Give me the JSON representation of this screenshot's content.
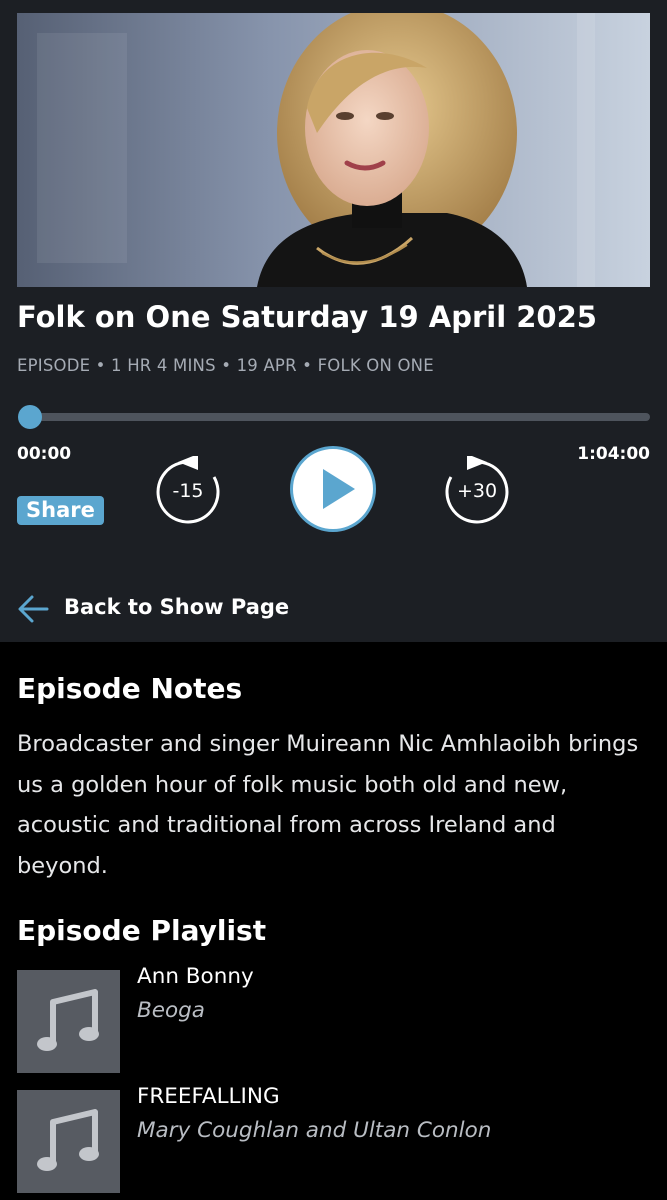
{
  "episode": {
    "title": "Folk on One Saturday 19 April 2025",
    "meta": "EPISODE • 1 HR 4 MINS • 19 APR • FOLK ON ONE"
  },
  "player": {
    "progress_fraction": 0,
    "elapsed": "00:00",
    "duration": "1:04:00",
    "rewind_label": "-15",
    "forward_label": "+30",
    "share_label": "Share",
    "accent_color": "#5ba6cf"
  },
  "nav": {
    "back_label": "Back to Show Page"
  },
  "notes": {
    "heading": "Episode Notes",
    "body": "Broadcaster and singer Muireann Nic Amhlaoibh brings us a golden hour of folk music both old and new, acoustic and traditional from across Ireland and beyond."
  },
  "playlist": {
    "heading": "Episode Playlist",
    "tracks": [
      {
        "title": "Ann Bonny",
        "artist": "Beoga",
        "icon": "music-note-icon"
      },
      {
        "title": "FREEFALLING",
        "artist": "Mary Coughlan and Ultan Conlon",
        "icon": "music-note-icon"
      }
    ]
  }
}
